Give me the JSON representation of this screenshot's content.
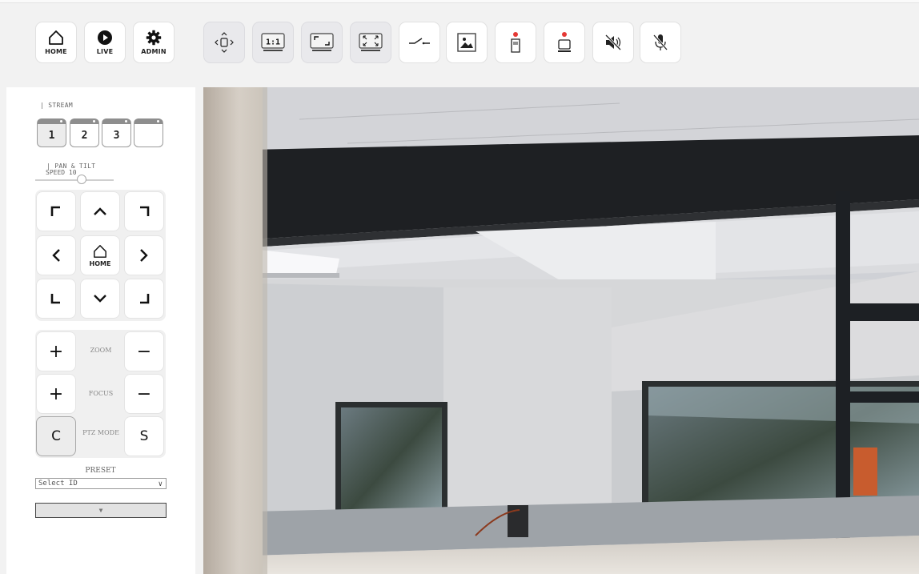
{
  "toolbar": {
    "nav": [
      {
        "label": "HOME",
        "icon": "home-icon"
      },
      {
        "label": "LIVE",
        "icon": "play-icon"
      },
      {
        "label": "ADMIN",
        "icon": "gear-icon"
      }
    ],
    "view": {
      "ptz_move_icon": "move-arrows-icon",
      "actual_size_label": "1:1",
      "fit_icon": "fit-window-icon",
      "fullscreen_icon": "fullscreen-icon",
      "relay_icon": "relay-switch-icon",
      "snapshot_icon": "snapshot-icon",
      "sd_record_icon": "sd-card-record-icon",
      "local_record_icon": "local-record-icon",
      "speaker_icon": "speaker-muted-icon",
      "mic_icon": "mic-muted-icon"
    },
    "record_color": "#e53935"
  },
  "stream": {
    "title": "| STREAM",
    "tabs": [
      "1",
      "2",
      "3",
      ""
    ],
    "active": "1"
  },
  "pan_tilt": {
    "title": "| PAN & TILT",
    "speed_label": "SPEED 10",
    "speed_value": 10,
    "home_label": "HOME"
  },
  "lens": {
    "zoom_label": "ZOOM",
    "focus_label": "FOCUS",
    "ptz_mode_label": "PTZ MODE",
    "plus": "+",
    "minus": "−",
    "mode_c": "C",
    "mode_s": "S"
  },
  "preset": {
    "title": "PRESET",
    "placeholder": "Select ID",
    "go_symbol": "▼"
  }
}
